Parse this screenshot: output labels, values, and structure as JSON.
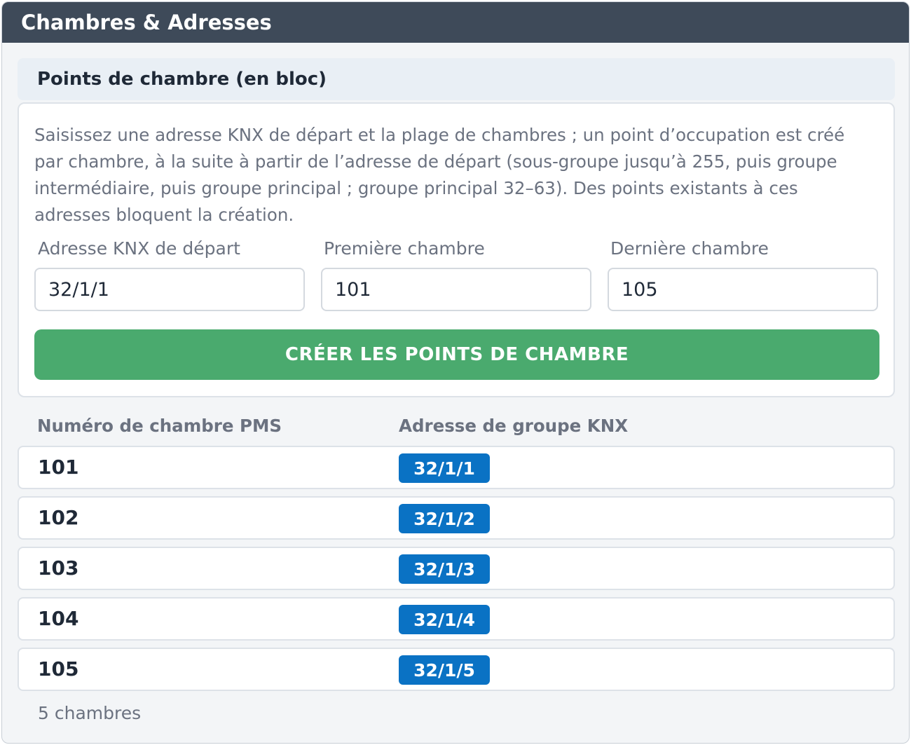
{
  "window": {
    "title": "Chambres & Adresses"
  },
  "section": {
    "title": "Points de chambre (en bloc)"
  },
  "form": {
    "description": "Saisissez une adresse KNX de départ et la plage de chambres ; un point d’occupation est créé par chambre, à la suite à partir de l’adresse de départ (sous-groupe jusqu’à 255, puis groupe intermédiaire, puis groupe principal ; groupe principal 32–63). Des points existants à ces adresses bloquent la création.",
    "start_address": {
      "label": "Adresse KNX de départ",
      "value": "32/1/1"
    },
    "first_room": {
      "label": "Première chambre",
      "value": "101"
    },
    "last_room": {
      "label": "Dernière chambre",
      "value": "105"
    },
    "create_button_label": "CRÉER LES POINTS DE CHAMBRE"
  },
  "table": {
    "columns": [
      "Numéro de chambre PMS",
      "Adresse de groupe KNX"
    ],
    "rows": [
      {
        "room": "101",
        "address": "32/1/1"
      },
      {
        "room": "102",
        "address": "32/1/2"
      },
      {
        "room": "103",
        "address": "32/1/3"
      },
      {
        "room": "104",
        "address": "32/1/4"
      },
      {
        "room": "105",
        "address": "32/1/5"
      }
    ],
    "count_label": "5 chambres"
  },
  "colors": {
    "titlebar": "#3e4a59",
    "create_button": "#4aaa6e",
    "address_badge": "#0a72c4"
  }
}
